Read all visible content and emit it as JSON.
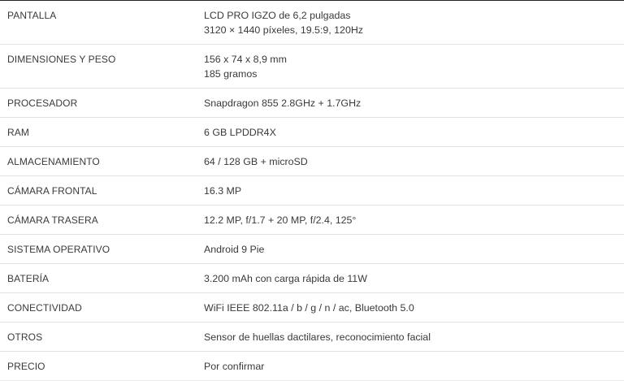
{
  "specs": [
    {
      "label": "PANTALLA",
      "lines": [
        "LCD PRO IGZO de 6,2 pulgadas",
        "3120 × 1440 píxeles, 19.5:9, 120Hz"
      ]
    },
    {
      "label": "DIMENSIONES Y PESO",
      "lines": [
        "156 x 74 x 8,9 mm",
        "185 gramos"
      ]
    },
    {
      "label": "PROCESADOR",
      "lines": [
        "Snapdragon 855 2.8GHz + 1.7GHz"
      ]
    },
    {
      "label": "RAM",
      "lines": [
        "6 GB LPDDR4X"
      ]
    },
    {
      "label": "ALMACENAMIENTO",
      "lines": [
        "64 / 128 GB + microSD"
      ]
    },
    {
      "label": "CÁMARA FRONTAL",
      "lines": [
        "16.3 MP"
      ]
    },
    {
      "label": "CÁMARA TRASERA",
      "lines": [
        "12.2 MP, f/1.7 + 20 MP, f/2.4, 125°"
      ]
    },
    {
      "label": "SISTEMA OPERATIVO",
      "lines": [
        "Android 9 Pie"
      ]
    },
    {
      "label": "BATERÍA",
      "lines": [
        "3.200 mAh con carga rápida de 11W"
      ]
    },
    {
      "label": "CONECTIVIDAD",
      "lines": [
        "WiFi IEEE 802.11a / b / g / n / ac, Bluetooth 5.0"
      ]
    },
    {
      "label": "OTROS",
      "lines": [
        "Sensor de huellas dactilares, reconocimiento facial"
      ]
    },
    {
      "label": "PRECIO",
      "lines": [
        "Por confirmar"
      ]
    }
  ]
}
